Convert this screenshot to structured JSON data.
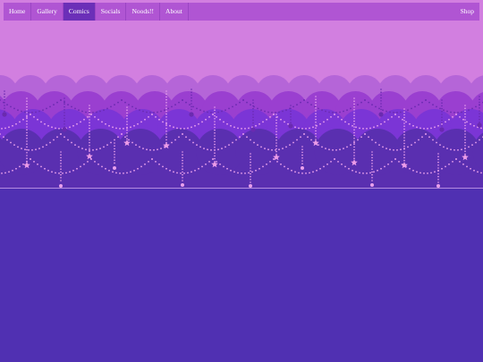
{
  "nav": {
    "items": [
      {
        "label": "Home"
      },
      {
        "label": "Gallery"
      },
      {
        "label": "Comics"
      },
      {
        "label": "Socials"
      },
      {
        "label": "Noods!!"
      },
      {
        "label": "About"
      }
    ],
    "active_index": 2,
    "shop_label": "Shop"
  },
  "colors": {
    "sky": "#d27fe0",
    "page_background": "#5030b2",
    "nav_background": "#b055d3",
    "nav_active": "#6b2fb8",
    "cloud_layers": [
      "#b565d8",
      "#9a3fd0",
      "#7b35d6",
      "#5a2fb0"
    ],
    "bead_light": "#e9a0ec",
    "bead_dark": "#6a2ab0",
    "star": "#ec9ce8"
  },
  "decor": {
    "banner_style": "layered scalloped clouds with hanging bead garlands and stars"
  }
}
